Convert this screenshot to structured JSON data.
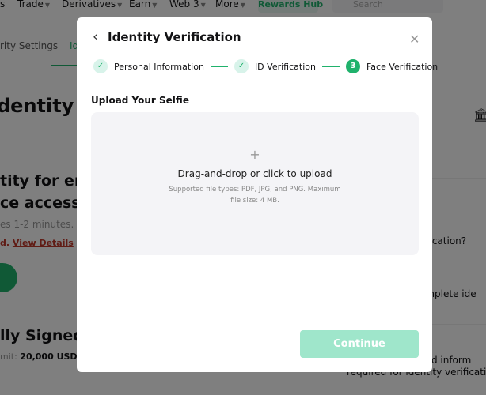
{
  "nav": {
    "items": [
      "s",
      "Trade",
      "Derivatives",
      "Earn",
      "Web 3",
      "More"
    ],
    "rewards": "Rewards Hub",
    "search_placeholder": "Search"
  },
  "tabs": {
    "security": "rity Settings",
    "identity": "Id"
  },
  "background": {
    "heading": "dentity Ve",
    "line1": "tity for enha",
    "line2": "ce access.",
    "duration": "es 1-2 minutes.",
    "prefix": "d.",
    "view_details": "View Details",
    "signed_up": "lly Signed Up",
    "limit_label": "mit:",
    "limit_value": "20,000 USDT",
    "faq": [
      "rification?",
      "omplete ide",
      "and inform",
      "required for identity verificati"
    ]
  },
  "modal": {
    "title": "Identity Verification",
    "steps": [
      {
        "label": "Personal Information",
        "status": "done"
      },
      {
        "label": "ID Verification",
        "status": "done"
      },
      {
        "number": "3",
        "label": "Face Verification",
        "status": "active"
      }
    ],
    "section_title": "Upload Your Selfie",
    "upload": {
      "plus": "+",
      "title": "Drag-and-drop or click to upload",
      "hint": "Supported file types: PDF, JPG, and PNG. Maximum file size: 4 MB."
    },
    "continue": "Continue"
  },
  "colors": {
    "accent": "#20b26c",
    "accent_disabled": "#9fe6cb",
    "link": "#c0392b"
  }
}
